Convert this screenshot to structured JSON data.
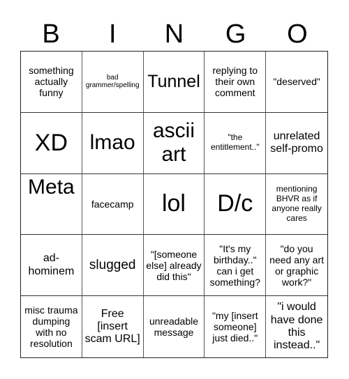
{
  "header": {
    "letters": [
      "B",
      "I",
      "N",
      "G",
      "O"
    ]
  },
  "grid": {
    "rows": [
      [
        "something actually funny",
        "bad grammer/spelling",
        "Tunnel",
        "replying to their own comment",
        "\"deserved\""
      ],
      [
        "XD",
        "lmao",
        "ascii art",
        "\"the entitlement..\"",
        "unrelated self-promo"
      ],
      [
        "Meta",
        "facecamp",
        "lol",
        "D/c",
        "mentioning BHVR as if anyone really cares"
      ],
      [
        "ad-hominem",
        "slugged",
        "\"[someone else] already did this\"",
        "\"It's my birthday..\" can i get something?",
        "\"do you need any art or graphic work?\""
      ],
      [
        "misc trauma dumping with no resolution",
        "Free [insert scam URL]",
        "unreadable message",
        "\"my [insert someone] just died..\"",
        "\"i would have done this instead..\""
      ]
    ]
  }
}
